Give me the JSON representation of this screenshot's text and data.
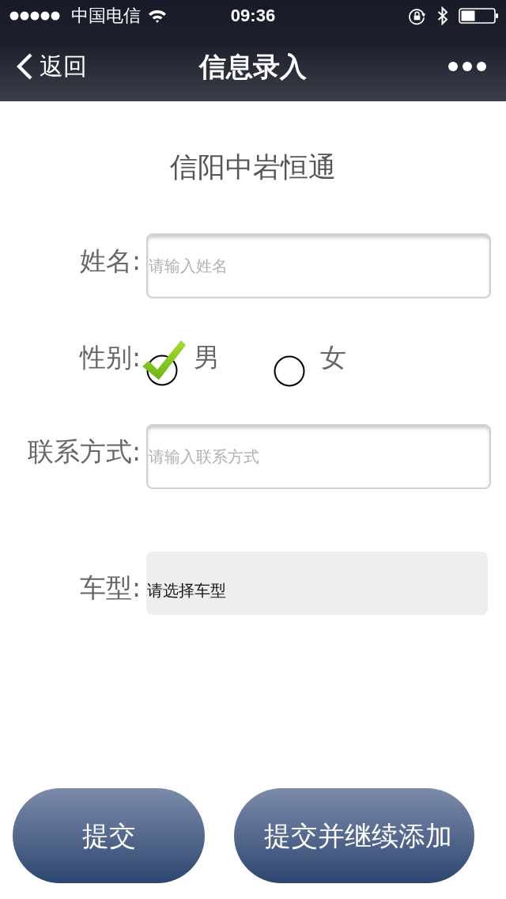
{
  "status_bar": {
    "carrier": "中国电信",
    "time": "09:36"
  },
  "nav_bar": {
    "back_label": "返回",
    "title": "信息录入"
  },
  "company_name": "信阳中岩恒通",
  "form": [
    {
      "kind": "text",
      "label": "姓名:",
      "placeholder": "请输入姓名"
    },
    {
      "kind": "radio",
      "label": "性别:",
      "options": [
        {
          "label": "男",
          "selected": true
        },
        {
          "label": "女",
          "selected": false
        }
      ]
    },
    {
      "kind": "text",
      "label": "联系方式:",
      "placeholder": "请输入联系方式"
    },
    {
      "kind": "select",
      "label": "车型:",
      "value": "请选择车型"
    }
  ],
  "buttons": [
    {
      "label": "提交"
    },
    {
      "label": "提交并继续添加"
    }
  ]
}
